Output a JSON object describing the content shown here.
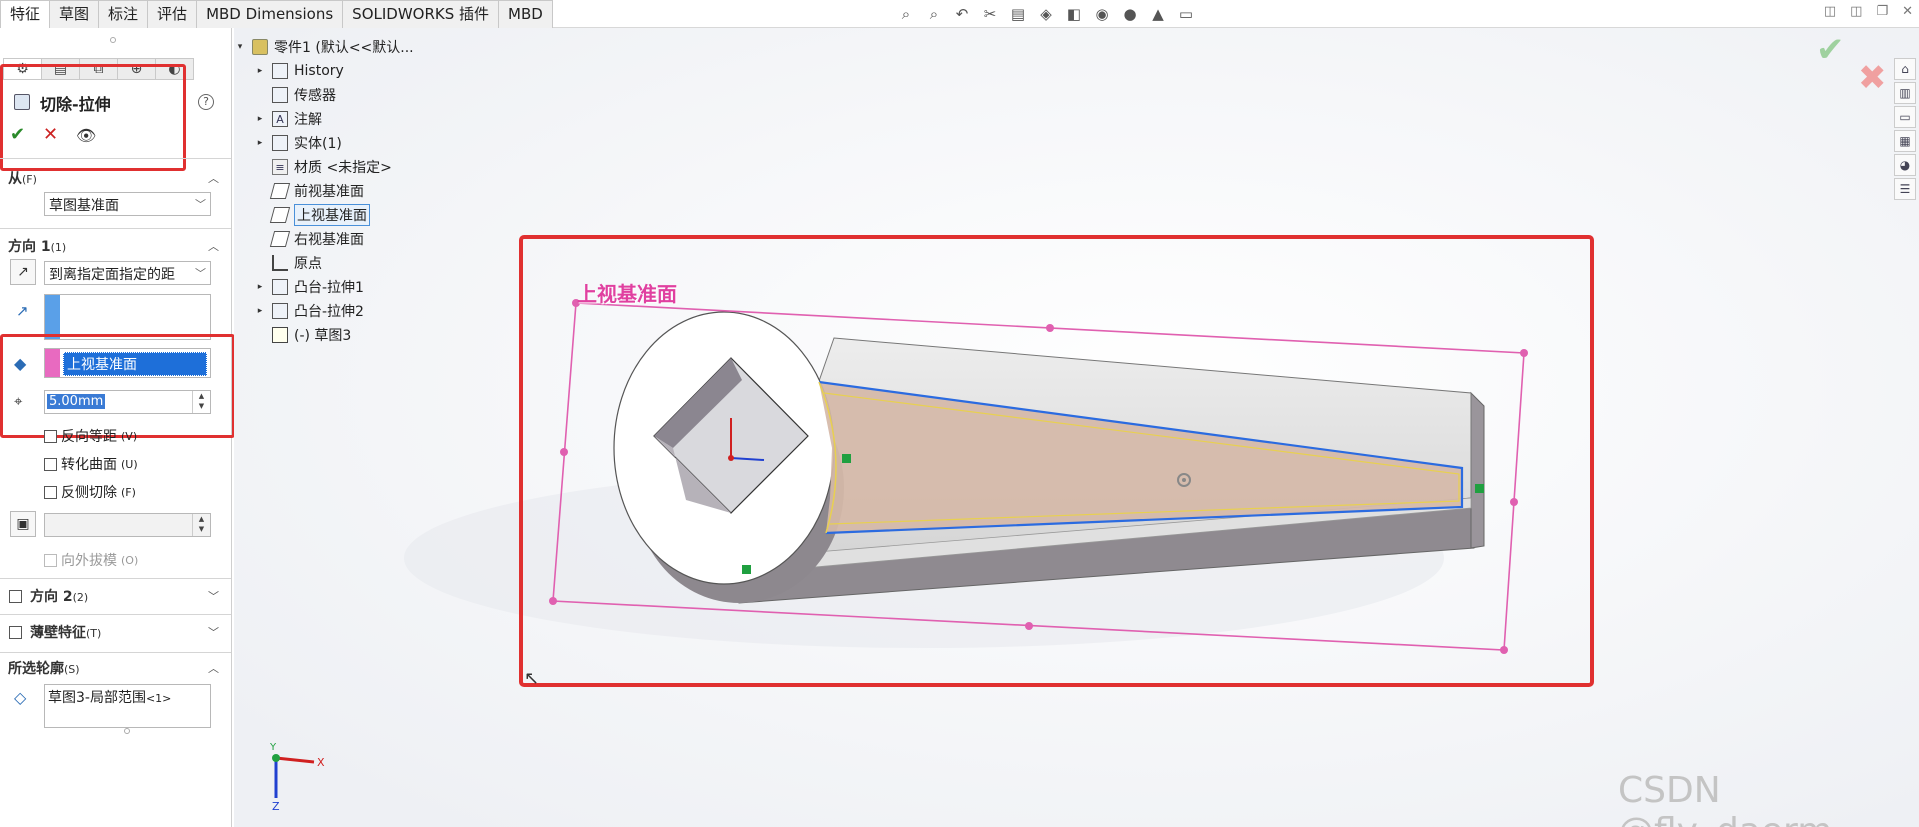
{
  "tabs": [
    "特征",
    "草图",
    "标注",
    "评估",
    "MBD Dimensions",
    "SOLIDWORKS 插件",
    "MBD"
  ],
  "active_tab": "特征",
  "pm": {
    "title": "切除-拉伸",
    "help": "?",
    "ok": "✔",
    "cancel": "✕",
    "preview": "👁",
    "from_label": "从",
    "from_key": "(F)",
    "from_value": "草图基准面",
    "dir1_label": "方向 1",
    "dir1_key": "(1)",
    "end_condition": "到离指定面指定的距",
    "face_value": "上视基准面",
    "offset_value": "5.00mm",
    "reverse_offset": "反向等距",
    "reverse_offset_key": "(V)",
    "translate_surface": "转化曲面",
    "translate_surface_key": "(U)",
    "flip_side": "反侧切除",
    "flip_side_key": "(F)",
    "draft_outward": "向外拔模",
    "draft_outward_key": "(O)",
    "dir2_label": "方向 2",
    "dir2_key": "(2)",
    "thin_label": "薄壁特征",
    "thin_key": "(T)",
    "contours_label": "所选轮廓",
    "contours_key": "(S)",
    "contour_value": "草图3-局部范围",
    "contour_suffix": "<1>"
  },
  "tree": {
    "root": "零件1 (默认<<默认...",
    "items": [
      {
        "label": "History",
        "icon": "history-folder-icon",
        "expandable": true
      },
      {
        "label": "传感器",
        "icon": "sensor-folder-icon",
        "expandable": false
      },
      {
        "label": "注解",
        "icon": "annotation-folder-icon",
        "expandable": true
      },
      {
        "label": "实体(1)",
        "icon": "solid-body-icon",
        "expandable": true
      },
      {
        "label": "材质 <未指定>",
        "icon": "material-icon",
        "expandable": false
      },
      {
        "label": "前视基准面",
        "icon": "plane-icon",
        "expandable": false
      },
      {
        "label": "上视基准面",
        "icon": "plane-icon",
        "expandable": false,
        "selected": true
      },
      {
        "label": "右视基准面",
        "icon": "plane-icon",
        "expandable": false
      },
      {
        "label": "原点",
        "icon": "origin-icon",
        "expandable": false
      },
      {
        "label": "凸台-拉伸1",
        "icon": "boss-extrude-icon",
        "expandable": true
      },
      {
        "label": "凸台-拉伸2",
        "icon": "boss-extrude-icon",
        "expandable": true
      },
      {
        "label": "(-) 草图3",
        "icon": "sketch-icon",
        "expandable": false
      }
    ]
  },
  "viewport": {
    "plane_label": "上视基准面",
    "triad_x": "X",
    "triad_y": "Y",
    "triad_z": "Z"
  },
  "watermark": "CSDN @fly_daerm",
  "colors": {
    "highlight_red": "#e03030",
    "plane_pink": "#e040a0",
    "selection_blue": "#3a7bd5",
    "face_tan": "#d5b8a8"
  }
}
